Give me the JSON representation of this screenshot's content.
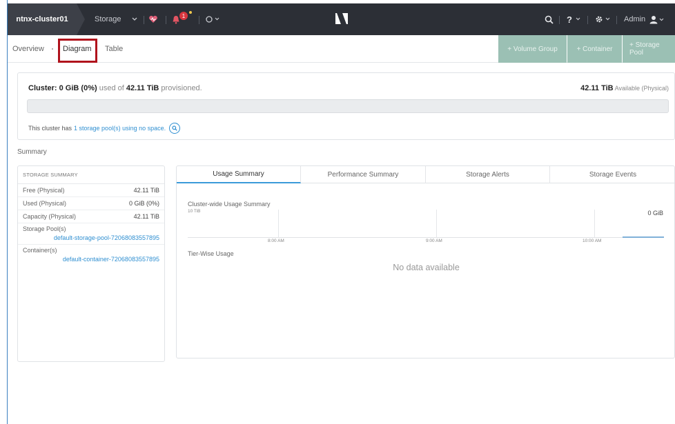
{
  "topbar": {
    "cluster_name": "ntnx-cluster01",
    "menu_label": "Storage",
    "alert_count": "1",
    "user_label": "Admin",
    "icons": [
      "chevron-down-icon",
      "heart-icon",
      "bell-icon",
      "circle-icon",
      "nutanix-logo",
      "search-icon",
      "help-icon",
      "gear-icon",
      "user-icon"
    ]
  },
  "subnav": {
    "tabs": [
      {
        "label": "Overview"
      },
      {
        "label": "Diagram"
      },
      {
        "label": "Table"
      }
    ],
    "actions": [
      {
        "label": "+ Volume Group"
      },
      {
        "label": "+ Container"
      },
      {
        "label": "+ Storage Pool"
      }
    ]
  },
  "cluster": {
    "prefix": "Cluster:",
    "used": "0 GiB (0%)",
    "used_of": "used of",
    "provisioned_total": "42.11 TiB",
    "provisioned_label": "provisioned.",
    "available": "42.11 TiB",
    "available_label": "Available (Physical)",
    "note_prefix": "This cluster has",
    "note_link": "1 storage pool(s) using no space.",
    "usage_fraction": 0
  },
  "summary_label": "Summary",
  "storage_summary": {
    "heading": "STORAGE SUMMARY",
    "rows": [
      {
        "label": "Free (Physical)",
        "value": "42.11 TiB"
      },
      {
        "label": "Used (Physical)",
        "value": "0 GiB (0%)"
      },
      {
        "label": "Capacity (Physical)",
        "value": "42.11 TiB"
      }
    ],
    "pools_label": "Storage Pool(s)",
    "pool_link": "default-storage-pool-72068083557895",
    "containers_label": "Container(s)",
    "container_link": "default-container-72068083557895"
  },
  "tabs": [
    {
      "label": "Usage Summary"
    },
    {
      "label": "Performance Summary"
    },
    {
      "label": "Storage Alerts"
    },
    {
      "label": "Storage Events"
    }
  ],
  "usage": {
    "title": "Cluster-wide Usage Summary",
    "current_value": "0 GiB",
    "y_max_label": "10 TiB",
    "x_ticks": [
      "8:00 AM",
      "9:00 AM",
      "10:00 AM"
    ],
    "tier_label": "Tier-Wise Usage",
    "empty_message": "No data available"
  },
  "colors": {
    "topbar": "#2c2f36",
    "accent_link": "#2f8fd1",
    "action_button": "#9bc0b4",
    "highlight": "#b0121c",
    "alert": "#d9363e"
  }
}
